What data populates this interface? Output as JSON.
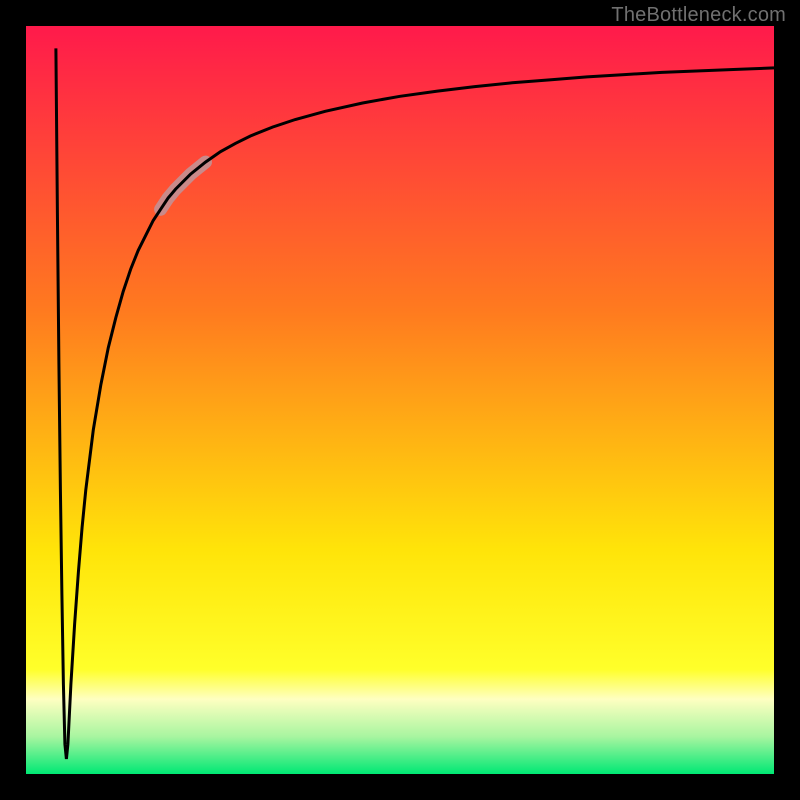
{
  "attribution": "TheBottleneck.com",
  "colors": {
    "gradient_top": "#ff1a4b",
    "gradient_upper_mid": "#ff7a1f",
    "gradient_mid": "#ffe409",
    "gradient_light_band": "#feffc1",
    "gradient_bottom": "#00e874",
    "curve": "#000000",
    "highlight": "#c98a8a",
    "frame": "#000000"
  },
  "chart_data": {
    "type": "line",
    "title": "",
    "xlabel": "",
    "ylabel": "",
    "xlim": [
      0,
      100
    ],
    "ylim": [
      0,
      100
    ],
    "series": [
      {
        "name": "bottleneck-curve",
        "x": [
          4,
          4.2,
          4.4,
          4.6,
          4.8,
          5,
          5.2,
          5.4,
          5.6,
          5.8,
          6,
          6.5,
          7,
          7.5,
          8,
          9,
          10,
          11,
          12,
          13,
          14,
          15,
          16,
          17,
          18,
          19,
          20,
          22,
          24,
          26,
          28,
          30,
          33,
          36,
          40,
          45,
          50,
          55,
          60,
          65,
          70,
          75,
          80,
          85,
          90,
          95,
          100
        ],
        "y": [
          97,
          75,
          55,
          38,
          24,
          12,
          4,
          2,
          4,
          8,
          12,
          20,
          27,
          33,
          38,
          46,
          52,
          57,
          61,
          64.5,
          67.5,
          70,
          72,
          74,
          75.5,
          77,
          78.2,
          80.2,
          81.8,
          83.2,
          84.3,
          85.3,
          86.5,
          87.5,
          88.6,
          89.7,
          90.6,
          91.3,
          91.9,
          92.4,
          92.8,
          93.2,
          93.5,
          93.8,
          94,
          94.2,
          94.4
        ]
      }
    ],
    "annotations": [
      {
        "name": "highlight-segment",
        "x_range": [
          18,
          25
        ],
        "applies_to_series": "bottleneck-curve"
      }
    ]
  }
}
